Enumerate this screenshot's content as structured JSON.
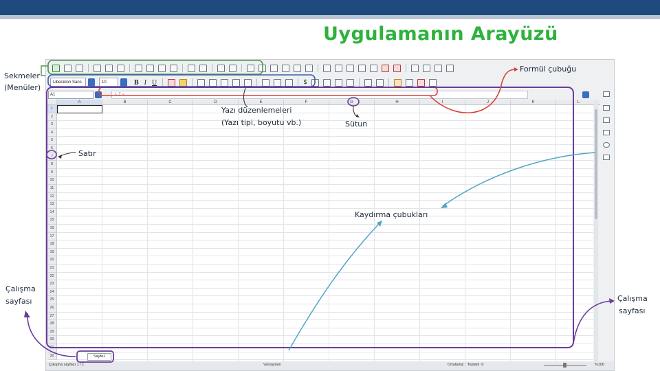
{
  "slide": {
    "title": "Uygulamanın Arayüzü"
  },
  "toolbar": {
    "font_name": "Liberation Sans",
    "font_size": "10",
    "bold_label": "B",
    "italic_label": "I",
    "underline_label": "U",
    "currency_label": "$"
  },
  "formula_bar": {
    "name_box": "A1",
    "fx_label": "fₓ  Σ  ="
  },
  "sheet": {
    "columns": [
      "A",
      "B",
      "C",
      "D",
      "E",
      "F",
      "G",
      "H",
      "I",
      "J",
      "K",
      "L"
    ],
    "rows": [
      "1",
      "2",
      "3",
      "4",
      "5",
      "6",
      "7",
      "8",
      "9",
      "10",
      "11",
      "12",
      "13",
      "14",
      "15",
      "16",
      "17",
      "18",
      "19",
      "20",
      "21",
      "22",
      "23",
      "24",
      "25",
      "26",
      "27",
      "28",
      "29",
      "30",
      "31",
      "32"
    ],
    "active_cell": "A1",
    "tab_label": "Sayfa1"
  },
  "statusbar": {
    "sheet_info": "Çalışma sayfası 1 / 1",
    "style": "Varsayılan",
    "summary": "Ortalama: ; Toplam: 0",
    "zoom": "%100"
  },
  "annotations": {
    "sekmeler": "Sekmeler",
    "menuler": "(Menüler)",
    "formul": "Formül çubuğu",
    "yazi": "Yazı düzenlemeleri",
    "yazi_sub": "(Yazı tipi, boyutu vb.)",
    "sutun": "Sütun",
    "satir": "Satır",
    "kaydirma": "Kaydırma çubukları",
    "calisma_left_1": "Çalışma",
    "calisma_left_2": "sayfası",
    "calisma_right_1": "Çalışma",
    "calisma_right_2": "sayfası"
  },
  "colors": {
    "title_green": "#2eb23c",
    "annotation_purple": "#6a3b9c",
    "annotation_green": "#4f9a4c",
    "annotation_red": "#d9433a",
    "annotation_blue": "#3c5ea8",
    "arrow_blue": "#4fa3c8",
    "band_navy": "#1f4a7d"
  }
}
